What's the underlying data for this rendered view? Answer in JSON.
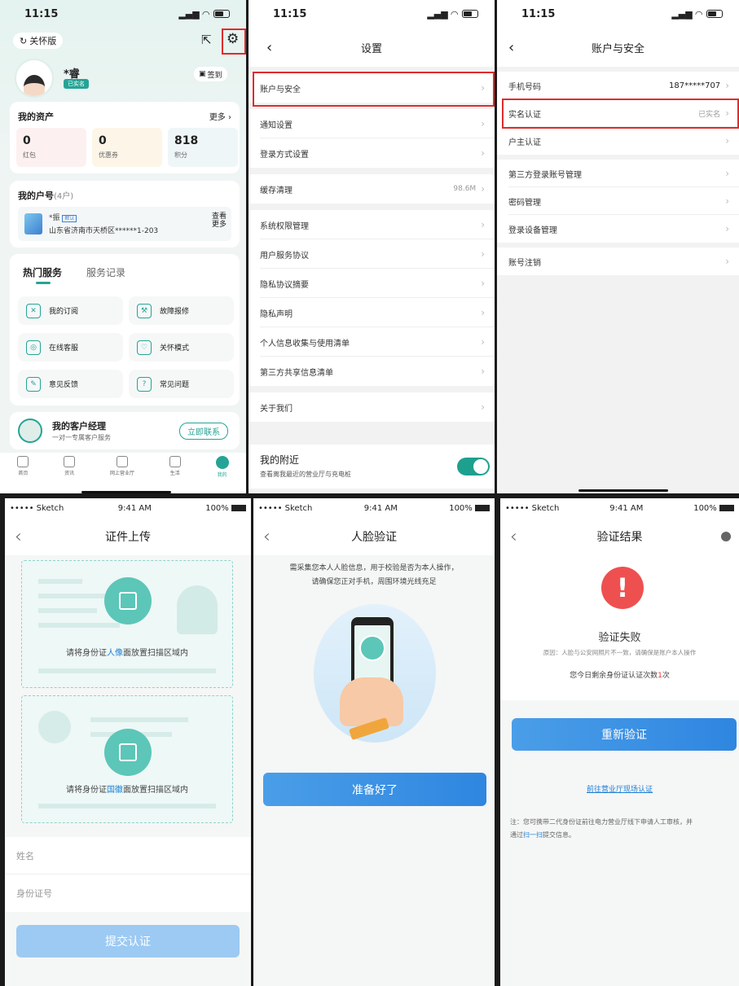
{
  "status": {
    "time": "11:15"
  },
  "ios_status": {
    "carrier": "••••• Sketch",
    "time": "9:41 AM",
    "battery": "100%"
  },
  "p1": {
    "care_mode": "关怀版",
    "user_name": "*睿",
    "verified_badge": "已实名",
    "checkin": "签到",
    "assets_title": "我的资产",
    "more": "更多",
    "assets": [
      {
        "value": "0",
        "label": "红包",
        "color": "#fdf0f0"
      },
      {
        "value": "0",
        "label": "优惠券",
        "color": "#fdf6e8"
      },
      {
        "value": "818",
        "label": "积分",
        "color": "#eef6f8"
      }
    ],
    "account_title": "我的户号",
    "account_count": "(4户)",
    "account_name": "*振",
    "account_tag": "默认",
    "account_addr": "山东省济南市天桥区******1-203",
    "view_more": "查看\n更多",
    "tab_hot": "热门服务",
    "tab_records": "服务记录",
    "services": [
      {
        "label": "我的订阅",
        "icon": "subscribe-icon",
        "glyph": "✕"
      },
      {
        "label": "故障报修",
        "icon": "repair-icon",
        "glyph": "⚒"
      },
      {
        "label": "在线客服",
        "icon": "headset-icon",
        "glyph": "◎"
      },
      {
        "label": "关怀模式",
        "icon": "heart-icon",
        "glyph": "♡"
      },
      {
        "label": "意见反馈",
        "icon": "feedback-icon",
        "glyph": "✎"
      },
      {
        "label": "常见问题",
        "icon": "question-icon",
        "glyph": "?"
      }
    ],
    "manager_title": "我的客户经理",
    "manager_sub": "一对一专属客户服务",
    "contact_now": "立即联系",
    "tabs": [
      {
        "label": "首页",
        "icon": "home-icon"
      },
      {
        "label": "资讯",
        "icon": "news-icon"
      },
      {
        "label": "网上营业厅",
        "icon": "hall-icon"
      },
      {
        "label": "生活",
        "icon": "life-icon"
      },
      {
        "label": "我的",
        "icon": "mine-icon"
      }
    ]
  },
  "p2": {
    "title": "设置",
    "groups": [
      [
        {
          "label": "账户与安全",
          "value": ""
        }
      ],
      [
        {
          "label": "通知设置",
          "value": ""
        },
        {
          "label": "登录方式设置",
          "value": ""
        }
      ],
      [
        {
          "label": "缓存清理",
          "value": "98.6M"
        }
      ],
      [
        {
          "label": "系统权限管理",
          "value": ""
        },
        {
          "label": "用户服务协议",
          "value": ""
        },
        {
          "label": "隐私协议摘要",
          "value": ""
        },
        {
          "label": "隐私声明",
          "value": ""
        },
        {
          "label": "个人信息收集与使用清单",
          "value": ""
        },
        {
          "label": "第三方共享信息清单",
          "value": ""
        }
      ],
      [
        {
          "label": "关于我们",
          "value": ""
        }
      ]
    ],
    "nearby_title": "我的附近",
    "nearby_sub": "查看离我最近的营业厅与充电桩"
  },
  "p3": {
    "title": "账户与安全",
    "groups": [
      [
        {
          "label": "手机号码",
          "value": "187*****707"
        },
        {
          "label": "实名认证",
          "value": "已实名"
        },
        {
          "label": "户主认证",
          "value": ""
        }
      ],
      [
        {
          "label": "第三方登录账号管理",
          "value": ""
        },
        {
          "label": "密码管理",
          "value": ""
        },
        {
          "label": "登录设备管理",
          "value": ""
        }
      ],
      [
        {
          "label": "账号注销",
          "value": ""
        }
      ]
    ]
  },
  "p4": {
    "title": "证件上传",
    "front_pre": "请将身份证",
    "front_hl": "人像",
    "front_post": "面放置扫描区域内",
    "back_pre": "请将身份证",
    "back_hl": "国徽",
    "back_post": "面放置扫描区域内",
    "name_ph": "姓名",
    "id_ph": "身份证号",
    "submit": "提交认证"
  },
  "p5": {
    "title": "人脸验证",
    "desc1": "需采集您本人人脸信息，用于校验是否为本人操作，",
    "desc2": "请确保您正对手机，周围环境光线充足",
    "ready": "准备好了"
  },
  "p6": {
    "title": "验证结果",
    "status": "验证失败",
    "reason": "原因：人脸与公安网照片不一致，请确保是账户本人操作",
    "remain_pre": "您今日剩余身份证认证次数",
    "remain_num": "1",
    "remain_post": "次",
    "retry": "重新验证",
    "hall_link": "前往营业厅现场认证",
    "note1": "注：您可携带二代身份证前往电力营业厅线下申请人工审核，并",
    "note2_pre": "通过",
    "note2_link": "扫一扫",
    "note2_post": "提交信息。"
  },
  "colors": {
    "teal": "#25a495",
    "blue": "#3a8ee6",
    "red": "#e02b2b"
  }
}
